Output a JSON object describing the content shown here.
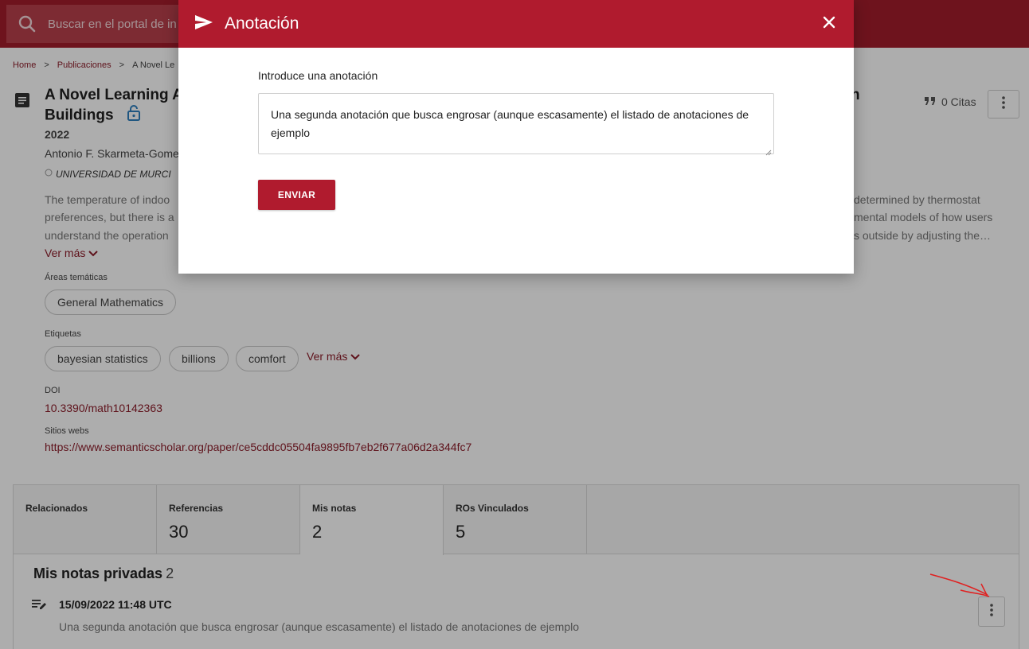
{
  "search": {
    "placeholder": "Buscar en el portal de in"
  },
  "breadcrumb": {
    "home": "Home",
    "sep1": ">",
    "publications": "Publicaciones",
    "sep2": ">",
    "current": "A Novel Le"
  },
  "publication": {
    "title_line1": "A Novel Learning Al",
    "title_line2": "Buildings",
    "title_tail": "n",
    "year": "2022",
    "authors": "Antonio F. Skarmeta-Gome",
    "affiliation": "UNIVERSIDAD DE MURCI",
    "cites": "0 Citas",
    "abstract_left": [
      "The temperature of indoo",
      "preferences, but there is a",
      "understand the operation"
    ],
    "abstract_right": [
      "determined by thermostat",
      "mental models of how users",
      "s outside by adjusting the…"
    ],
    "see_more": "Ver más",
    "areas_label": "Áreas temáticas",
    "areas": [
      "General Mathematics"
    ],
    "tags_label": "Etiquetas",
    "tags": [
      "bayesian statistics",
      "billions",
      "comfort"
    ],
    "tags_more": "Ver más",
    "doi_label": "DOI",
    "doi": "10.3390/math10142363",
    "websites_label": "Sitios webs",
    "website": "https://www.semanticscholar.org/paper/ce5cddc05504fa9895fb7eb2f677a06d2a344fc7"
  },
  "tabs": [
    {
      "label": "Relacionados",
      "count": ""
    },
    {
      "label": "Referencias",
      "count": "30"
    },
    {
      "label": "Mis notas",
      "count": "2"
    },
    {
      "label": "ROs Vinculados",
      "count": "5"
    }
  ],
  "notes": {
    "title": "Mis notas privadas",
    "count": "2",
    "items": [
      {
        "date": "15/09/2022 11:48 UTC",
        "text": "Una segunda anotación que busca engrosar (aunque escasamente) el listado de anotaciones de ejemplo"
      }
    ]
  },
  "modal": {
    "title": "Anotación",
    "field_label": "Introduce una anotación",
    "field_value": "Una segunda anotación que busca engrosar (aunque escasamente) el listado de anotaciones de ejemplo",
    "submit": "ENVIAR"
  },
  "colors": {
    "brand": "#b01b2e",
    "topbar": "#a31c2b",
    "link": "#8d1d2a",
    "annotation": "#e02020"
  },
  "icons": [
    "search-icon",
    "document-icon",
    "lock-open-icon",
    "quote-icon",
    "more-vert-icon",
    "chevron-down-icon",
    "note-edit-icon",
    "send-icon",
    "close-icon"
  ]
}
